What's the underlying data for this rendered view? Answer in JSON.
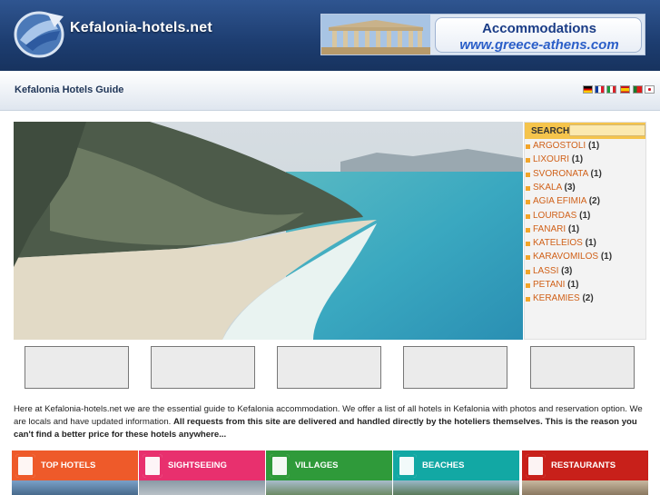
{
  "header": {
    "site_title": "Kefalonia-hotels.net",
    "banner_title": "Accommodations",
    "banner_url": "www.greece-athens.com"
  },
  "subbar": {
    "title": "Kefalonia Hotels Guide",
    "flags": [
      "german-flag",
      "french-flag",
      "italian-flag",
      "spanish-flag",
      "portuguese-flag",
      "japanese-flag"
    ]
  },
  "sidebar": {
    "search_label": "SEARCH",
    "search_value": "",
    "locations": [
      {
        "name": "ARGOSTOLI",
        "count": "(1)"
      },
      {
        "name": "LIXOURI",
        "count": "(1)"
      },
      {
        "name": "SVORONATA",
        "count": "(1)"
      },
      {
        "name": "SKALA",
        "count": "(3)"
      },
      {
        "name": "AGIA EFIMIA",
        "count": "(2)"
      },
      {
        "name": "LOURDAS",
        "count": "(1)"
      },
      {
        "name": "FANARI",
        "count": "(1)"
      },
      {
        "name": "KATELEIOS",
        "count": "(1)"
      },
      {
        "name": "KARAVOMILOS",
        "count": "(1)"
      },
      {
        "name": "LASSI",
        "count": "(3)"
      },
      {
        "name": "PETANI",
        "count": "(1)"
      },
      {
        "name": "KERAMIES",
        "count": "(2)"
      }
    ]
  },
  "intro": {
    "text_normal": "Here at Kefalonia-hotels.net we are the essential guide to Kefalonia accommodation. We offer a list of all hotels in Kefalonia with photos and reservation option. We are locals and have updated information. ",
    "text_bold": "All requests from this site are delivered and handled directly by the hoteliers themselves. This is the reason you can't find a better price for these hotels anywhere..."
  },
  "categories": [
    {
      "label": "TOP HOTELS",
      "color": "#ee5a2a",
      "icon": "bed-icon"
    },
    {
      "label": "SIGHTSEEING",
      "color": "#e8306e",
      "icon": "camera-icon"
    },
    {
      "label": "VILLAGES",
      "color": "#2f9a3a",
      "icon": "village-icon"
    },
    {
      "label": "BEACHES",
      "color": "#12a8a4",
      "icon": "beach-icon"
    },
    {
      "label": "RESTAURANTS",
      "color": "#c8201a",
      "icon": "fork-knife-icon"
    }
  ],
  "colors": {
    "header_bg": "#1d3d70",
    "search_bar": "#f5c44c",
    "location_link": "#d06018"
  }
}
